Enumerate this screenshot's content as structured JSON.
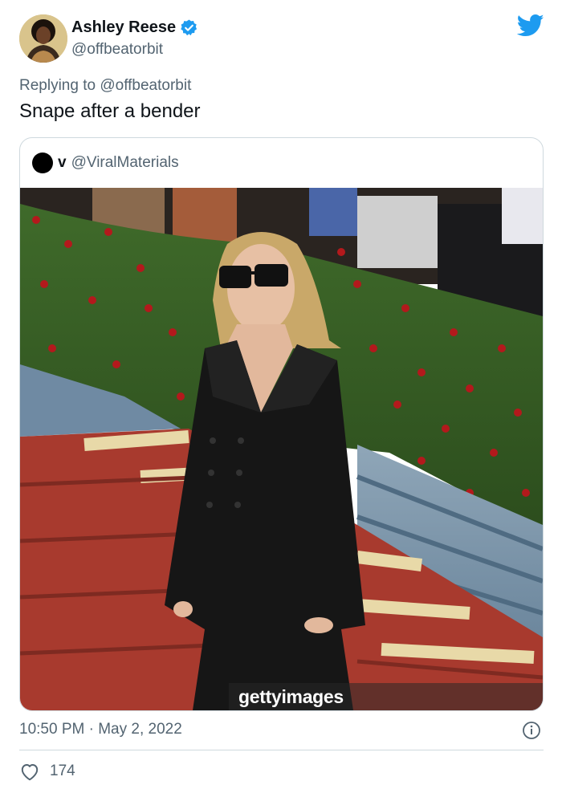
{
  "author": {
    "name": "Ashley Reese",
    "handle": "@offbeatorbit",
    "verified": true
  },
  "reply_context": {
    "prefix": "Replying to ",
    "mention": "@offbeatorbit"
  },
  "tweet": {
    "text": "Snape after a bender"
  },
  "quoted_tweet": {
    "name": "v",
    "handle": "@ViralMaterials",
    "photo_watermark": "gettyimages"
  },
  "meta": {
    "timestamp": "10:50 PM · May 2, 2022",
    "likes": "174"
  },
  "icons": {
    "verified": "verified-badge-icon",
    "logo": "twitter-bird-icon",
    "info": "info-icon",
    "like": "heart-icon"
  },
  "colors": {
    "brand": "#1d9bf0",
    "text": "#0f1419",
    "secondary": "#536471",
    "border": "#cfd9de"
  }
}
